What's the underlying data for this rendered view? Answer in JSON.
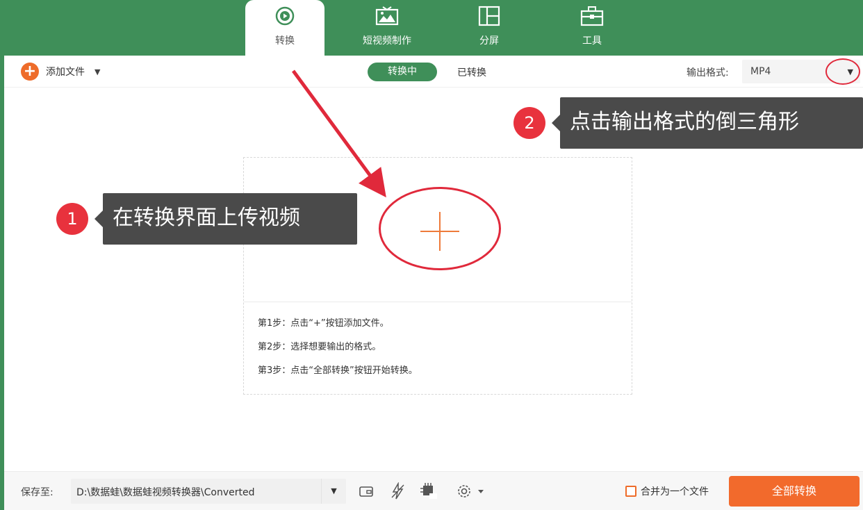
{
  "nav": {
    "tabs": [
      {
        "label": "转换",
        "icon": "convert-icon",
        "active": true
      },
      {
        "label": "短视频制作",
        "icon": "image-tv-icon",
        "active": false
      },
      {
        "label": "分屏",
        "icon": "split-screen-icon",
        "active": false
      },
      {
        "label": "工具",
        "icon": "toolbox-icon",
        "active": false
      }
    ]
  },
  "toolbar": {
    "add_file_label": "添加文件",
    "segments": {
      "converting": "转换中",
      "converted": "已转换"
    },
    "output_format_label": "输出格式:",
    "output_format_value": "MP4"
  },
  "drop_area": {
    "steps": [
      "第1步：点击“+”按钮添加文件。",
      "第2步：选择想要输出的格式。",
      "第3步：点击“全部转换”按钮开始转换。"
    ]
  },
  "annotations": {
    "one": {
      "number": "1",
      "text": "在转换界面上传视频"
    },
    "two": {
      "number": "2",
      "text": "点击输出格式的倒三角形"
    }
  },
  "footer": {
    "save_to_label": "保存至:",
    "path": "D:\\数据蛙\\数据蛙视频转换器\\Converted",
    "merge_label": "合并为一个文件",
    "convert_all_label": "全部转换"
  },
  "colors": {
    "brand_green": "#3f8f59",
    "accent_orange": "#f26a2c",
    "annotation_red": "#e0293b",
    "callout_gray": "#4a4a4a"
  }
}
